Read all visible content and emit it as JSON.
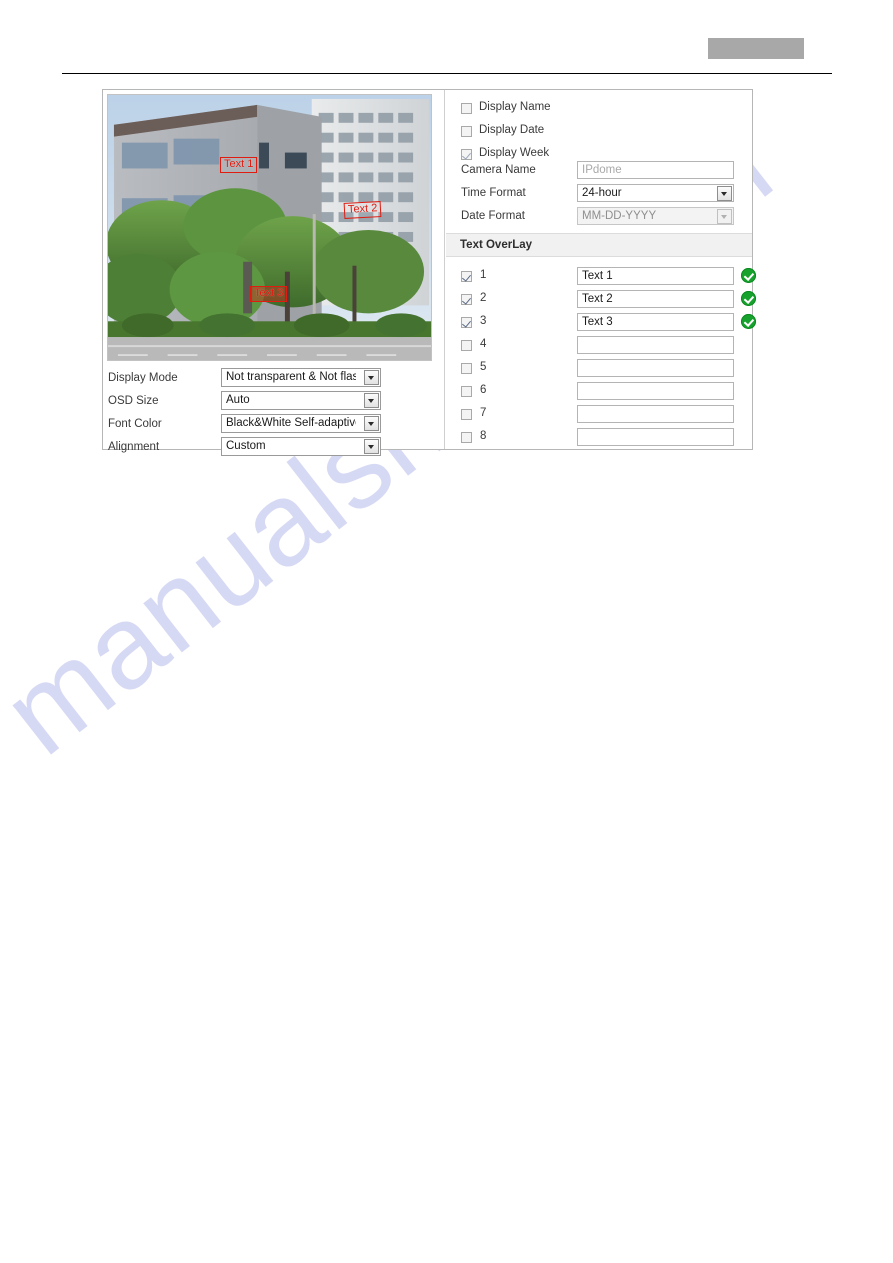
{
  "page": {
    "header_redaction_color": "#a8a8a8",
    "watermark_text": "manualshive.com",
    "watermark_color": "#c9cdf0",
    "accent_success_color": "#16a22d",
    "osd_box_color": "#e01b10"
  },
  "preview": {
    "osd_boxes": [
      {
        "label": "Text 1"
      },
      {
        "label": "Text 2"
      },
      {
        "label": "Text 3"
      }
    ]
  },
  "left_controls": {
    "rows": [
      {
        "label": "Display Mode",
        "value": "Not transparent & Not flashing"
      },
      {
        "label": "OSD Size",
        "value": "Auto"
      },
      {
        "label": "Font Color",
        "value": "Black&White Self-adaptive"
      },
      {
        "label": "Alignment",
        "value": "Custom"
      }
    ]
  },
  "display_options": {
    "checkboxes": [
      {
        "label": "Display Name",
        "checked": false
      },
      {
        "label": "Display Date",
        "checked": false
      },
      {
        "label": "Display Week",
        "checked": true,
        "disabled": true
      }
    ],
    "fields": [
      {
        "label": "Camera Name",
        "value": "IPdome",
        "is_placeholder": true,
        "type": "text",
        "disabled": false
      },
      {
        "label": "Time Format",
        "value": "24-hour",
        "is_placeholder": false,
        "type": "select",
        "disabled": false
      },
      {
        "label": "Date Format",
        "value": "MM-DD-YYYY",
        "is_placeholder": false,
        "type": "select",
        "disabled": true
      }
    ]
  },
  "text_overlay": {
    "section_title": "Text OverLay",
    "rows": [
      {
        "number": "1",
        "checked": true,
        "value": "Text 1",
        "status_ok": true
      },
      {
        "number": "2",
        "checked": true,
        "value": "Text 2",
        "status_ok": true
      },
      {
        "number": "3",
        "checked": true,
        "value": "Text 3",
        "status_ok": true
      },
      {
        "number": "4",
        "checked": false,
        "value": "",
        "status_ok": false
      },
      {
        "number": "5",
        "checked": false,
        "value": "",
        "status_ok": false
      },
      {
        "number": "6",
        "checked": false,
        "value": "",
        "status_ok": false
      },
      {
        "number": "7",
        "checked": false,
        "value": "",
        "status_ok": false
      },
      {
        "number": "8",
        "checked": false,
        "value": "",
        "status_ok": false
      }
    ]
  }
}
